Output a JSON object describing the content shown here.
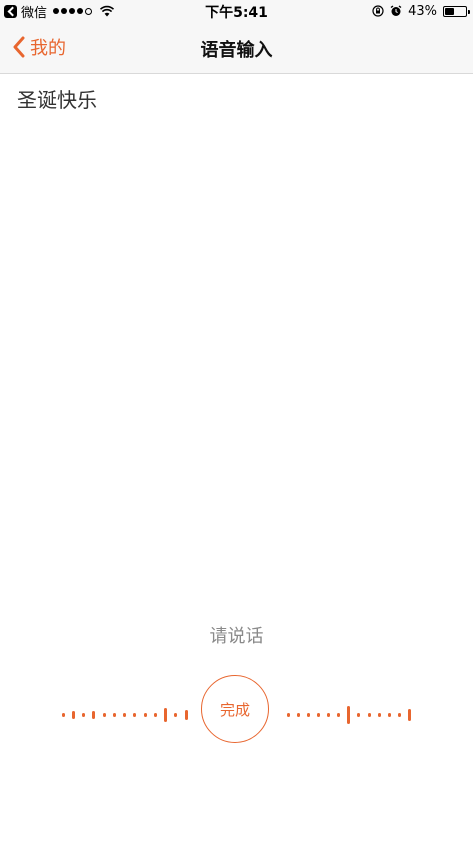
{
  "status_bar": {
    "carrier": "微信",
    "time": "下午5:41",
    "battery_text": "43%",
    "battery_level": 0.43,
    "signal_strength": 4,
    "signal_max": 5
  },
  "nav": {
    "back_label": "我的",
    "title": "语音输入"
  },
  "content": {
    "recognized_text": "圣诞快乐"
  },
  "voice": {
    "prompt": "请说话",
    "done_label": "完成"
  },
  "colors": {
    "accent": "#e8662f"
  }
}
